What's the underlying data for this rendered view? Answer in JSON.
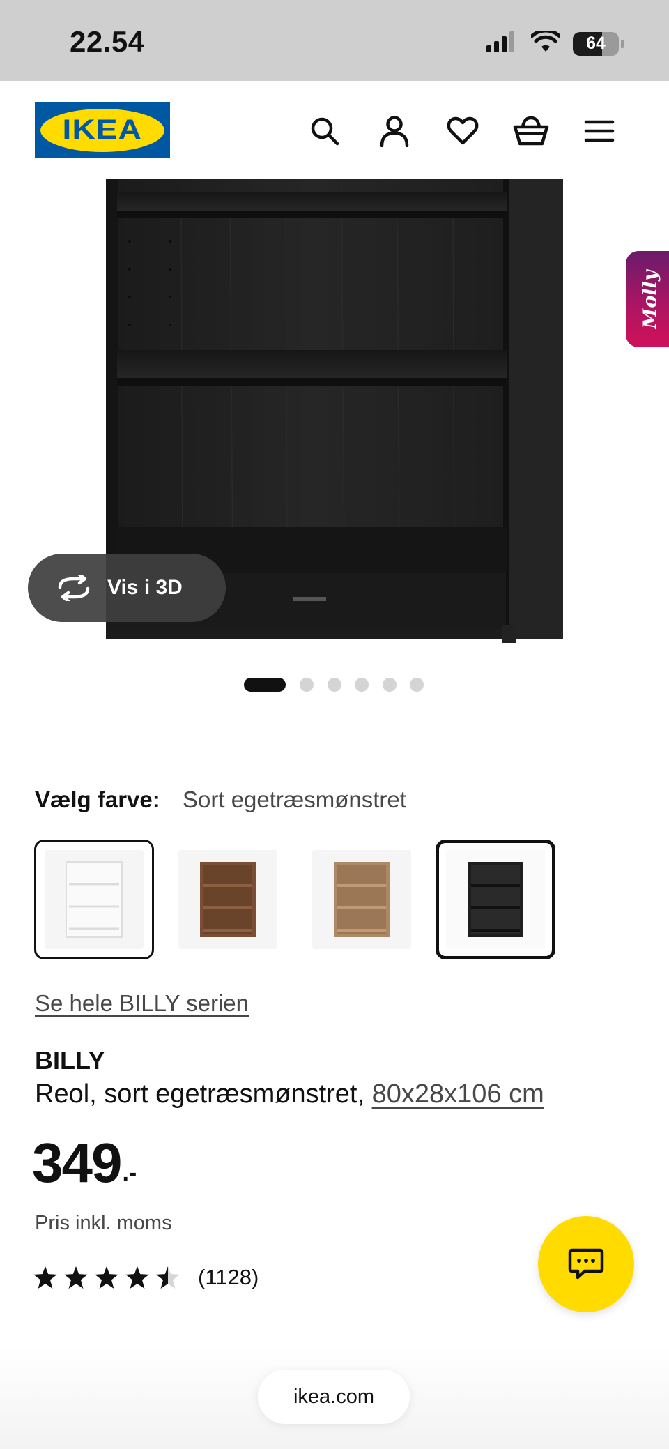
{
  "status_bar": {
    "time": "22.54",
    "battery": "64",
    "battery_level": 0.64
  },
  "header": {
    "logo_text": "IKEA",
    "icons": [
      "search-icon",
      "account-icon",
      "heart-icon",
      "basket-icon",
      "menu-icon"
    ]
  },
  "gallery": {
    "view_3d_label": "Vis i 3D",
    "molly_label": "Molly",
    "image_count": 6,
    "current_image": 1
  },
  "color_picker": {
    "label": "Vælg farve:",
    "selected_value": "Sort egetræsmønstret",
    "swatches": [
      {
        "name": "white",
        "color": "#f2f2f2",
        "selected": false
      },
      {
        "name": "brown walnut",
        "color": "#7a4f33",
        "selected": false
      },
      {
        "name": "oak veneer",
        "color": "#ad8865",
        "selected": false
      },
      {
        "name": "black oak",
        "color": "#1e1e1e",
        "selected": true
      }
    ]
  },
  "product": {
    "series_link": "Se hele BILLY serien",
    "name": "BILLY",
    "description": "Reol, sort egetræsmønstret, ",
    "size": "80x28x106 cm",
    "price": "349",
    "price_suffix": ".-",
    "price_note": "Pris inkl. moms",
    "rating": 4.5,
    "review_count": "(1128)"
  },
  "browser": {
    "url": "ikea.com"
  },
  "colors": {
    "ikea_blue": "#0058a3",
    "ikea_yellow": "#ffdb00",
    "molly_gradient_start": "#6a1b6b",
    "molly_gradient_end": "#d0105a"
  }
}
